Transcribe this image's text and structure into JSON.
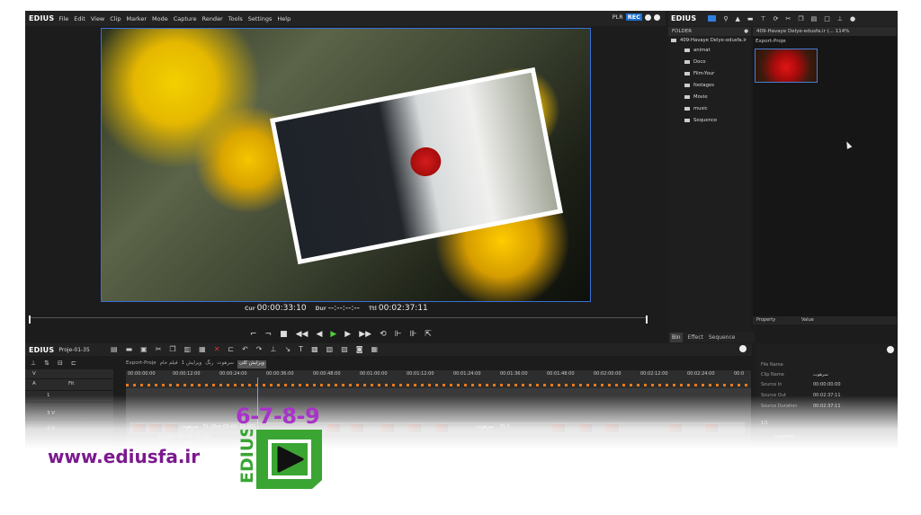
{
  "app": {
    "name": "EDIUS",
    "menu": [
      "File",
      "Edit",
      "View",
      "Clip",
      "Marker",
      "Mode",
      "Capture",
      "Render",
      "Tools",
      "Settings",
      "Help"
    ],
    "plr": "PLR",
    "rec": "REC"
  },
  "player": {
    "cur_label": "Cur",
    "cur_value": "00:00:33:10",
    "dur_label": "Dur",
    "dur_value": "--:--:--:--",
    "ttl_label": "Ttl",
    "ttl_value": "00:02:37:11"
  },
  "bin": {
    "name": "EDIUS",
    "folder_header": "FOLDER",
    "root": "409-Havaye Delye-edusfa.ir",
    "folders": [
      "animat",
      "Doco",
      "Film-Your",
      "footages",
      "Movie",
      "music",
      "Sequence"
    ],
    "clips_header": "409-Havaye Delye-edusfa.ir (...  114%",
    "clip_name": "Export-Proje",
    "property_label": "Property",
    "value_label": "Value",
    "tabs": [
      "Bin",
      "Effect",
      "Sequence marker"
    ]
  },
  "timeline": {
    "name": "EDIUS",
    "project": "Proje-01-35",
    "seq_tabs": [
      "Export-Proje",
      "فیلم خام",
      "ویرایش 1",
      "رنگ",
      "سرهوت",
      "ویرایش کلی"
    ],
    "active_tab": "ویرایش کلی",
    "ruler_labels": [
      "00:00:00:00",
      "00:00:12:00",
      "00:00:24:00",
      "00:00:36:00",
      "00:00:48:00",
      "00:01:00:00",
      "00:01:12:00",
      "00:01:24:00",
      "00:01:36:00",
      "00:01:48:00",
      "00:02:00:00",
      "00:02:12:00",
      "00:02:24:00",
      "00:0"
    ],
    "tracks": [
      "V",
      "A",
      "1",
      "3 V",
      "2 V"
    ],
    "fit_label": "Fit",
    "clip_label_1": "TL [Dur:00:00:33:00]",
    "clip_label_2": "سرهوت",
    "clip_label_3": "TL [...",
    "lower_label": "TL [Dur:00:02:37:11]"
  },
  "info": {
    "rows": [
      {
        "k": "File Name",
        "v": ""
      },
      {
        "k": "Clip Name",
        "v": "سرهوت"
      },
      {
        "k": "Source In",
        "v": "00:00:00:00"
      },
      {
        "k": "Source Out",
        "v": "00:02:37:11"
      },
      {
        "k": "Source Duration",
        "v": "00:02:37:11"
      }
    ],
    "layer_count": "1/1",
    "layouter": "Layouter"
  },
  "overlay": {
    "url": "www.ediusfa.ir",
    "versions": "6-7-8-9",
    "brand": "EDIUS"
  },
  "colors": {
    "accent": "#3a6fd8",
    "play": "#4fce3a",
    "brand_purple": "#7b1a8e",
    "logo_green": "#3aa533"
  }
}
